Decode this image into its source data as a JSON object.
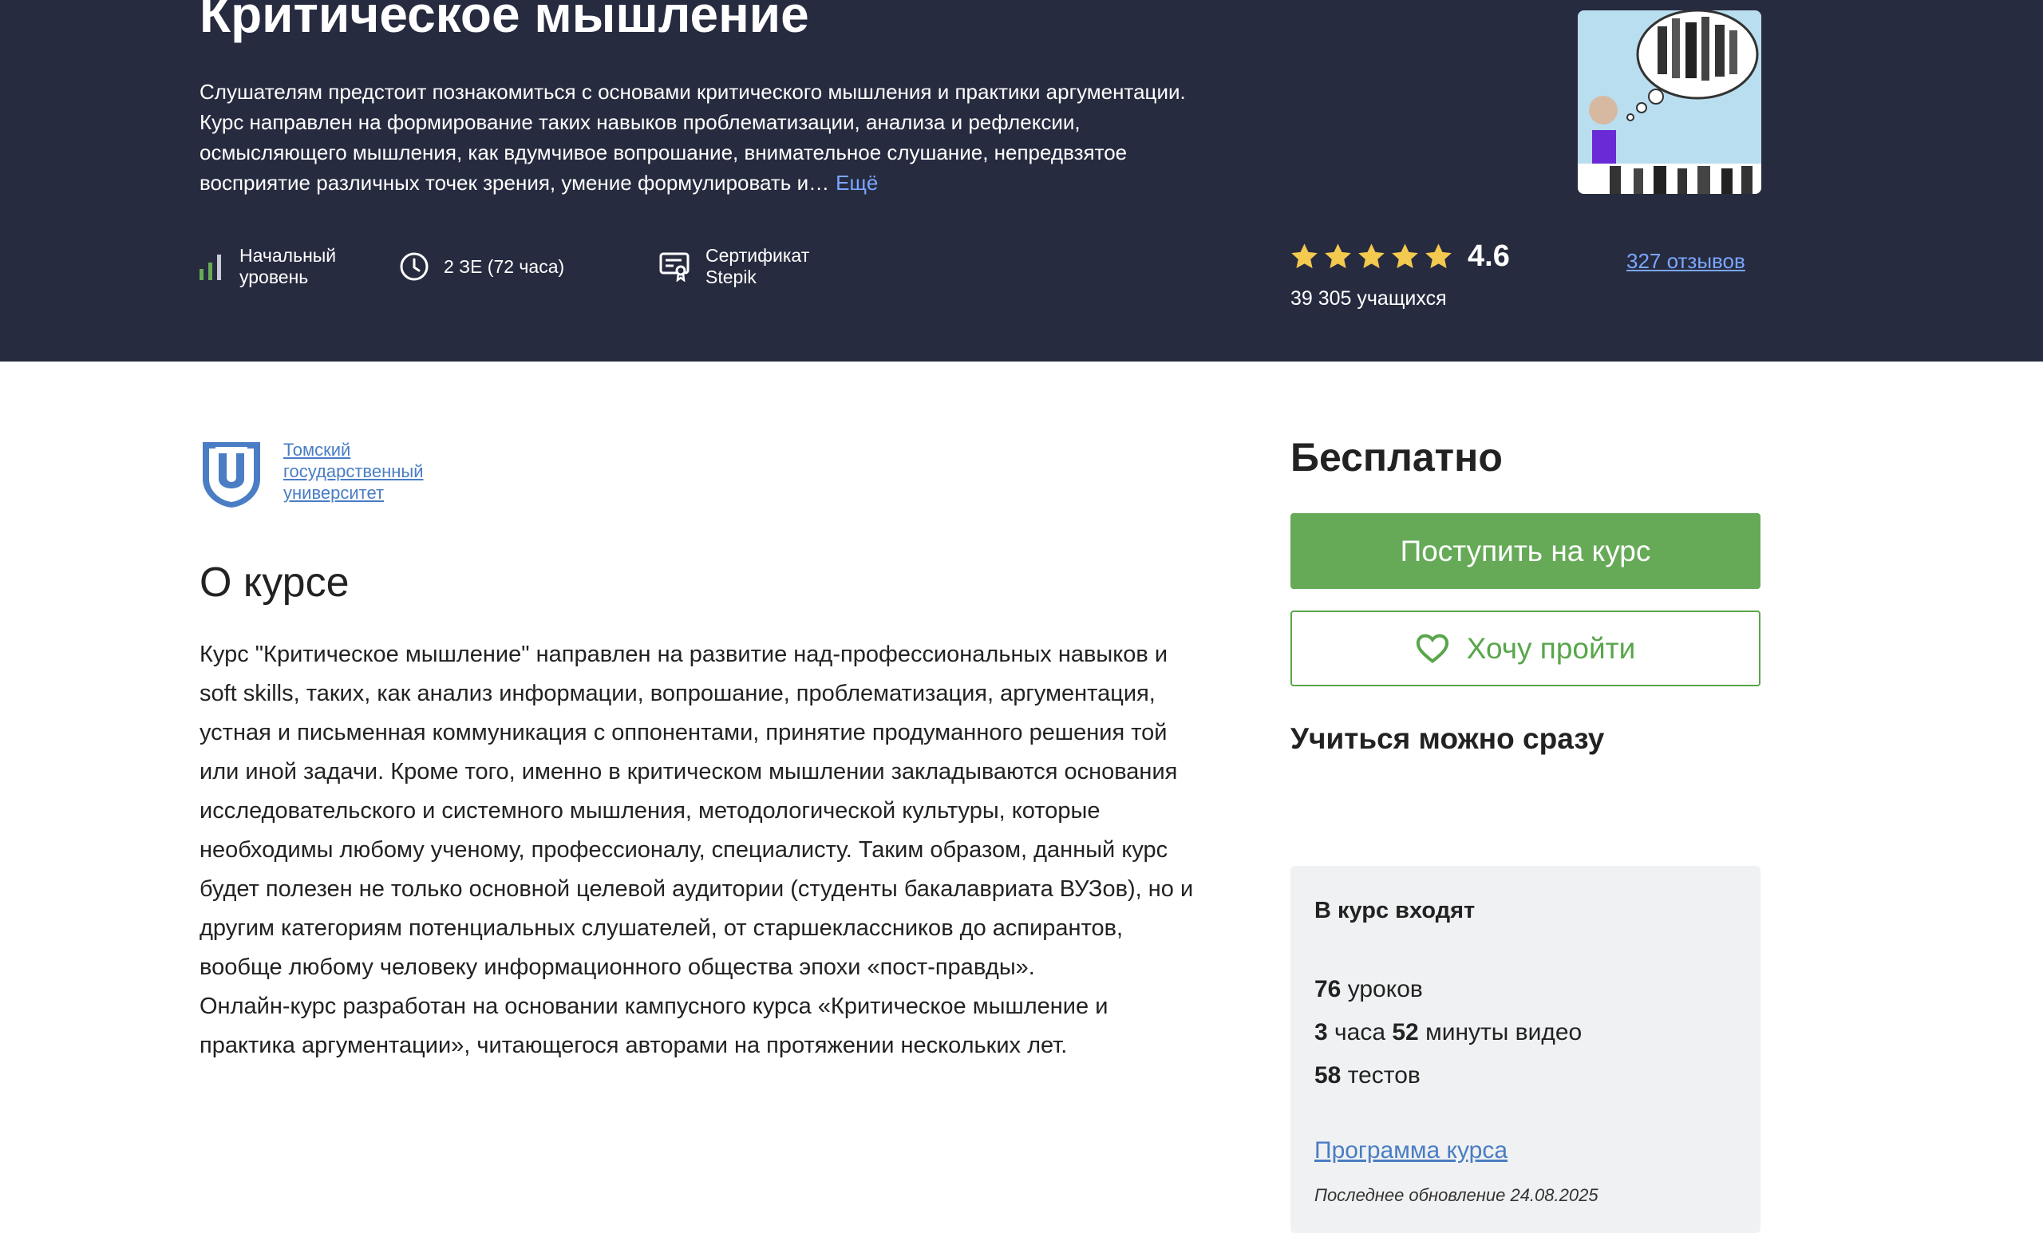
{
  "course": {
    "title": "Критическое мышление",
    "description": "Слушателям предстоит познакомиться с основами критического мышления и практики аргументации. Курс направлен на формирование таких навыков проблематизации, анализа и рефлексии, осмысляющего мышления, как вдумчивое вопрошание, внимательное слушание, непредвзятое восприятие различных точек зрения, умение формулировать и…",
    "more_link": "Ещё"
  },
  "meta": {
    "level_line1": "Начальный",
    "level_line2": "уровень",
    "hours": "2 ЗЕ (72 часа)",
    "cert_line1": "Сертификат",
    "cert_line2": "Stepik"
  },
  "rating": {
    "stars": 5,
    "value": "4.6",
    "learners": "39 305 учащихся",
    "reviews_link": "327 отзывов"
  },
  "provider": {
    "name": "Томский государственный университет",
    "logo_icon": "tsu-shield-logo"
  },
  "about": {
    "title": "О курсе",
    "paragraph1": "Курс \"Критическое мышление\" направлен на развитие над-профессиональных навыков и soft skills, таких, как анализ информации, вопрошание, проблематизация, аргументация, устная и письменная коммуникация с оппонентами, принятие продуманного решения той или иной задачи. Кроме того, именно в критическом мышлении закладываются основания исследовательского и системного мышления, методологической культуры, которые необходимы любому ученому, профессионалу, специалисту. Таким образом, данный курс будет полезен не только основной целевой аудитории (студенты бакалавриата ВУЗов), но и другим категориям потенциальных слушателей, от старшеклассников до аспирантов, вообще любому человеку информационного общества эпохи «пост-правды».",
    "paragraph2": "Онлайн-курс разработан на основании кампусного курса «Критическое мышление и практика аргументации», читающегося авторами на протяжении нескольких лет."
  },
  "sidebar": {
    "price": "Бесплатно",
    "enroll_button": "Поступить на курс",
    "wish_button": "Хочу пройти",
    "learn_now": "Учиться можно сразу",
    "includes": {
      "title": "В курс входят",
      "lessons_num": "76",
      "lessons_label": " уроков",
      "video_hours_num": "3",
      "video_hours_label": " часа ",
      "video_min_num": "52",
      "video_min_label": " минуты видео",
      "tests_num": "58",
      "tests_label": " тестов",
      "program_link": "Программа курса",
      "updated": "Последнее обновление 24.08.2025"
    }
  },
  "colors": {
    "hero_bg": "#272b3f",
    "accent_green": "#66aa58",
    "link_blue": "#7aa7ff",
    "star_yellow": "#f4c94f"
  }
}
